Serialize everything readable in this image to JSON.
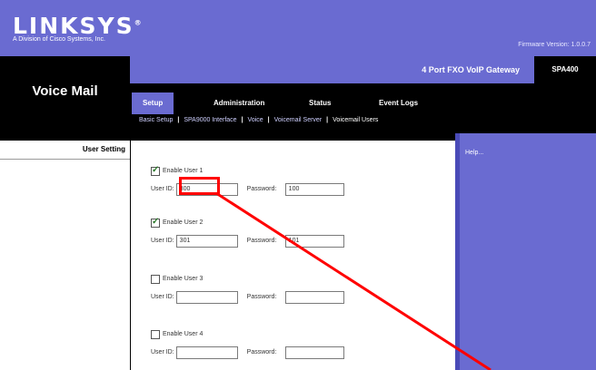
{
  "header": {
    "logo": "LINKSYS",
    "logo_mark": "®",
    "logo_tagline": "A Division of Cisco Systems, Inc.",
    "firmware": "Firmware Version: 1.0.0.7"
  },
  "section": {
    "title": "Voice Mail"
  },
  "product": {
    "name": "4 Port FXO VoIP Gateway",
    "model": "SPA400"
  },
  "tabs": [
    {
      "label": "Setup",
      "active": true
    },
    {
      "label": "Administration",
      "active": false
    },
    {
      "label": "Status",
      "active": false
    },
    {
      "label": "Event Logs",
      "active": false
    }
  ],
  "subtabs": [
    {
      "label": "Basic Setup",
      "active": false
    },
    {
      "label": "SPA9000 Interface",
      "active": false
    },
    {
      "label": "Voice",
      "active": false
    },
    {
      "label": "Voicemail Server",
      "active": false
    },
    {
      "label": "Voicemail Users",
      "active": true
    }
  ],
  "left": {
    "group_label": "User Setting"
  },
  "help": {
    "label": "Help..."
  },
  "users": [
    {
      "enable_label": "Enable User 1",
      "enabled": true,
      "user_id_label": "User ID:",
      "user_id": "300",
      "password_label": "Password:",
      "password": "100"
    },
    {
      "enable_label": "Enable User 2",
      "enabled": true,
      "user_id_label": "User ID:",
      "user_id": "301",
      "password_label": "Password:",
      "password": "101"
    },
    {
      "enable_label": "Enable User 3",
      "enabled": false,
      "user_id_label": "User ID:",
      "user_id": "",
      "password_label": "Password:",
      "password": ""
    },
    {
      "enable_label": "Enable User 4",
      "enabled": false,
      "user_id_label": "User ID:",
      "user_id": "",
      "password_label": "Password:",
      "password": ""
    }
  ],
  "annotation": {
    "color": "#ff0000"
  },
  "colors": {
    "brand_purple": "#6a6bd1",
    "black": "#000000"
  }
}
